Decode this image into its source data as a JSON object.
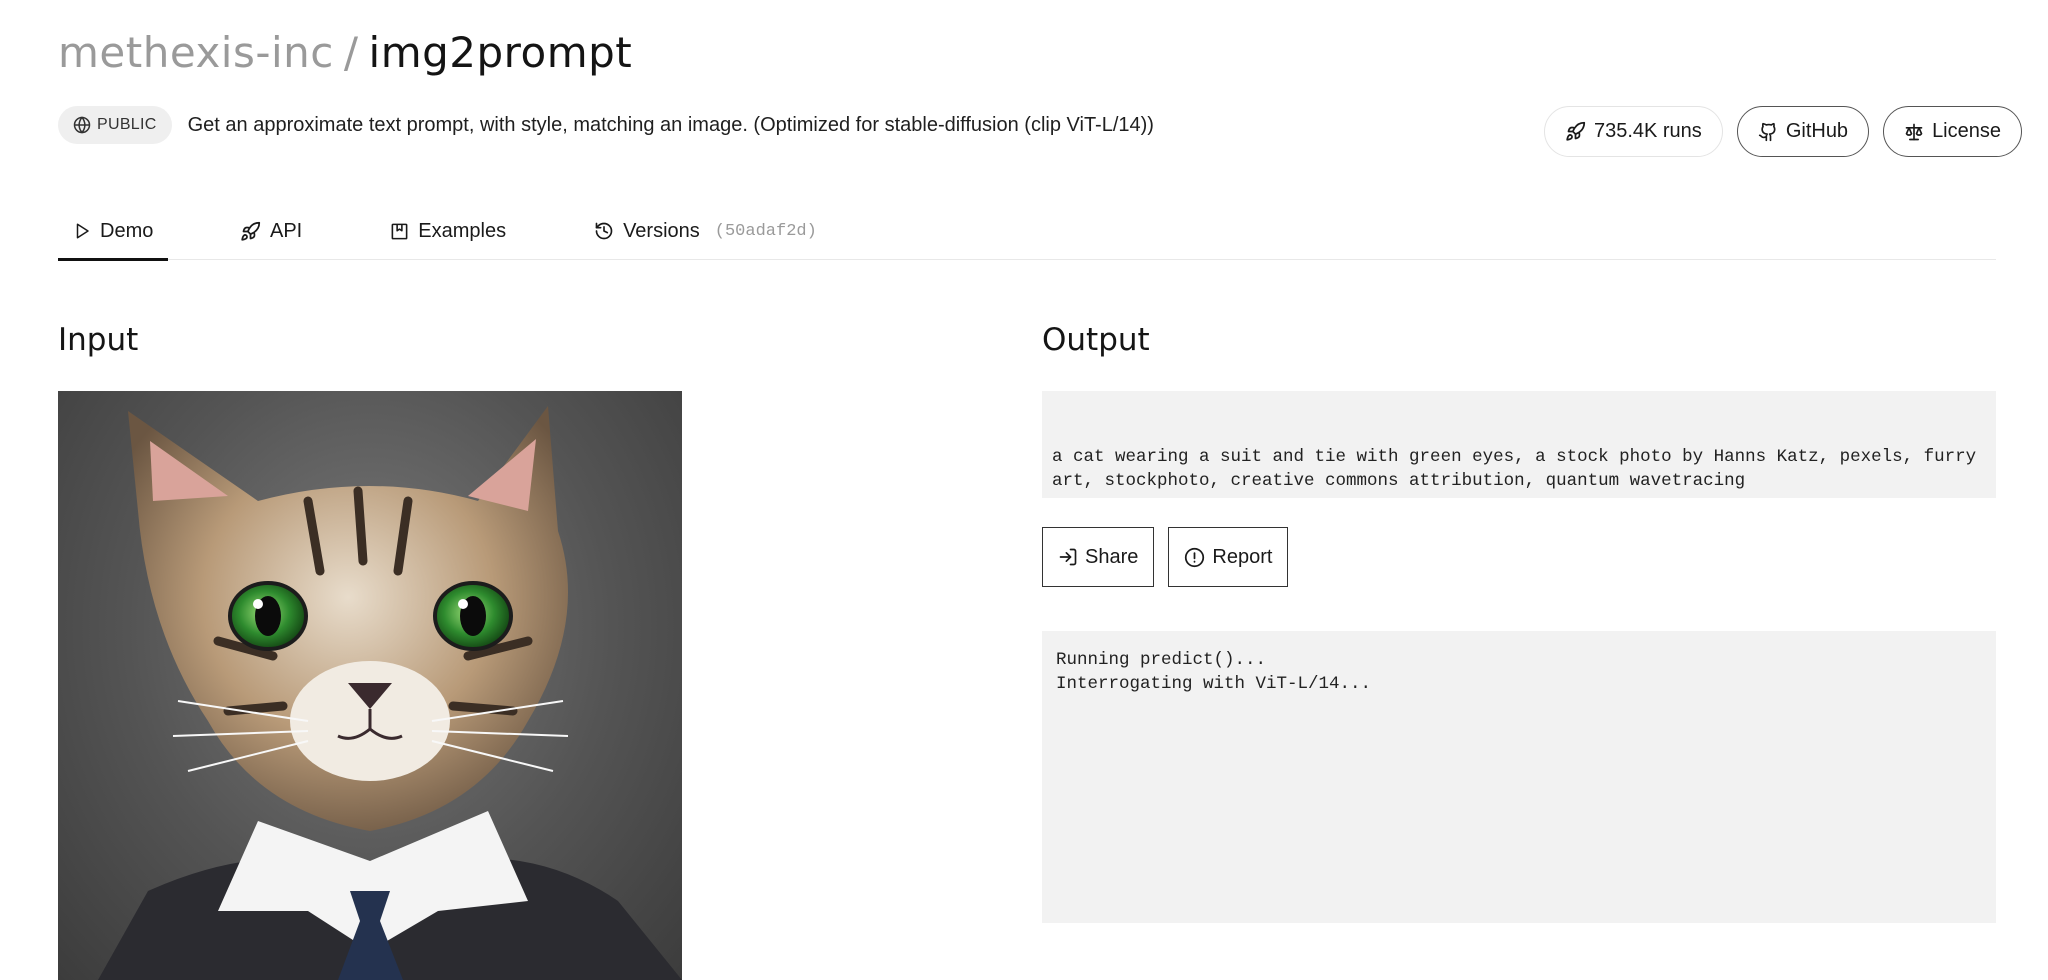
{
  "header": {
    "owner": "methexis-inc",
    "separator": "/",
    "model": "img2prompt",
    "visibility": "PUBLIC",
    "description": "Get an approximate text prompt, with style, matching an image. (Optimized for stable-diffusion (clip ViT-L/14))",
    "runs_label": "735.4K runs",
    "github_label": "GitHub",
    "license_label": "License"
  },
  "tabs": {
    "demo": "Demo",
    "api": "API",
    "examples": "Examples",
    "versions": "Versions",
    "version_hash": "(50adaf2d)",
    "active": "Demo"
  },
  "input": {
    "title": "Input",
    "image_icon": "cat-in-suit-image"
  },
  "output": {
    "title": "Output",
    "text": "a cat wearing a suit and tie with green eyes, a stock photo by Hanns Katz, pexels, furry art, stockphoto, creative commons attribution, quantum wavetracing",
    "share_label": "Share",
    "report_label": "Report",
    "logs": [
      "Running predict()...",
      "Interrogating with ViT-L/14..."
    ]
  },
  "icons": {
    "public": "globe-icon",
    "runs": "rocket-icon",
    "github": "github-icon",
    "license": "scale-icon",
    "demo": "play-icon",
    "api": "rocket-icon",
    "examples": "bookmark-icon",
    "versions": "history-icon",
    "share": "share-arrow-icon",
    "report": "alert-circle-icon"
  }
}
